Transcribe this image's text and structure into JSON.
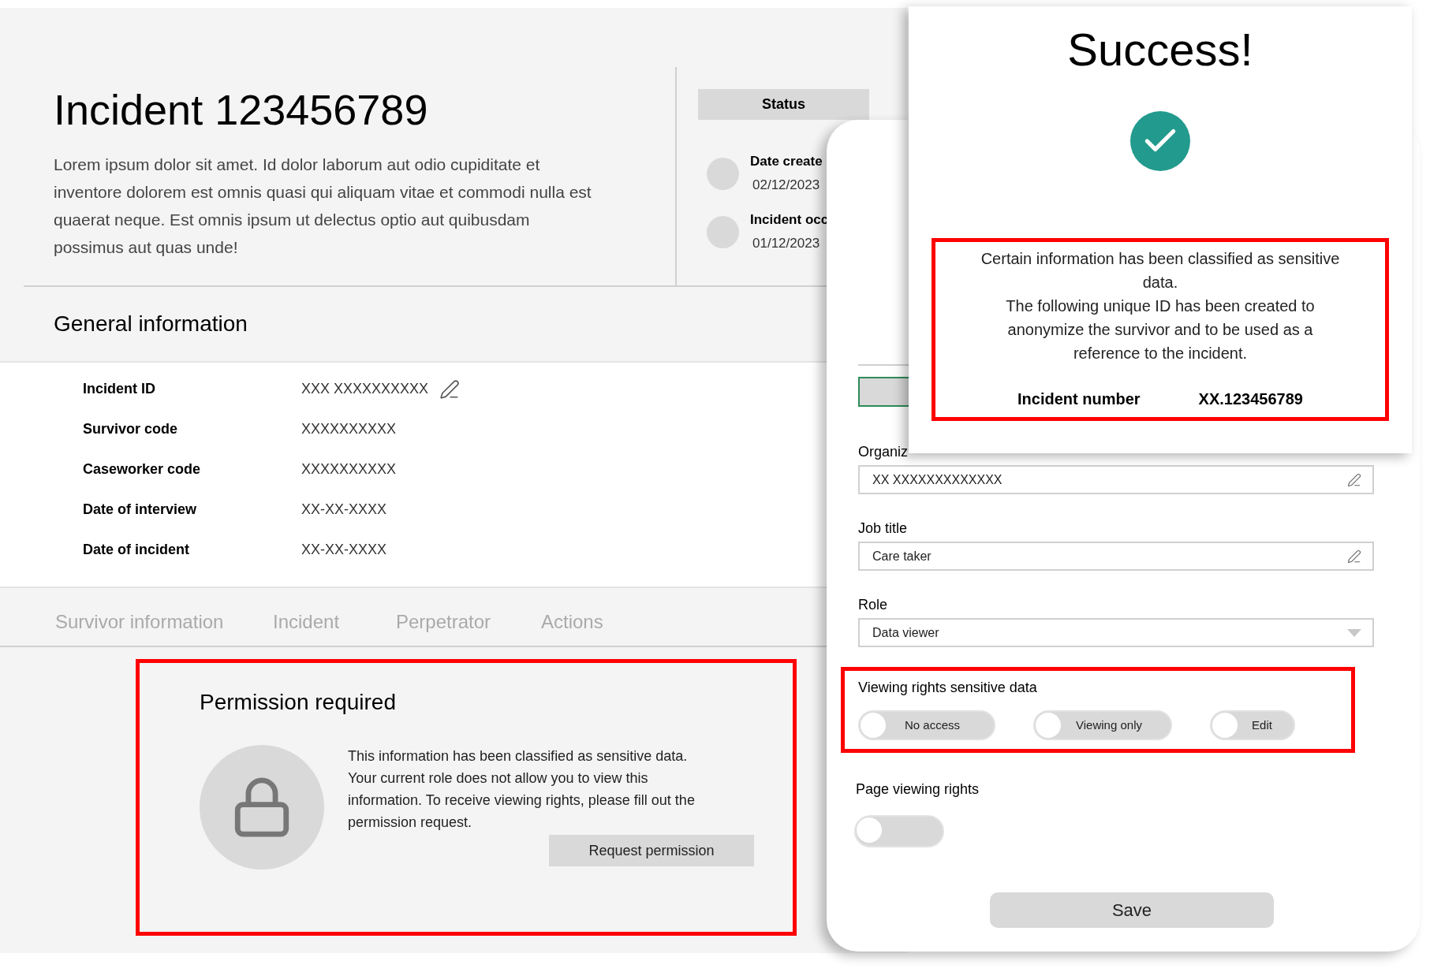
{
  "incident": {
    "title": "Incident 123456789",
    "description": "Lorem ipsum dolor sit amet. Id dolor laborum aut odio cupiditate et inventore dolorem est omnis quasi qui aliquam vitae et commodi nulla est quaerat neque. Est omnis ipsum ut delectus optio aut quibusdam possimus aut quas unde!"
  },
  "status": {
    "heading": "Status",
    "items": [
      {
        "label": "Date create",
        "date": "02/12/2023"
      },
      {
        "label": "Incident occ",
        "date": "01/12/2023"
      }
    ]
  },
  "general_information": {
    "heading": "General information",
    "rows": [
      {
        "label": "Incident ID",
        "value": "XXX XXXXXXXXXX",
        "editable": true
      },
      {
        "label": "Survivor code",
        "value": "XXXXXXXXXX",
        "editable": false
      },
      {
        "label": "Caseworker code",
        "value": "XXXXXXXXXX",
        "editable": false
      },
      {
        "label": "Date of interview",
        "value": "XX-XX-XXXX",
        "editable": false
      },
      {
        "label": "Date of incident",
        "value": "XX-XX-XXXX",
        "editable": false
      }
    ]
  },
  "tabs": [
    {
      "label": "Survivor information",
      "selected": false
    },
    {
      "label": "Incident",
      "selected": false
    },
    {
      "label": "Perpetrator",
      "selected": false
    },
    {
      "label": "Actions",
      "selected": false
    }
  ],
  "permission_notice": {
    "heading": "Permission required",
    "message": "This information has been classified as sensitive data. Your current role does not allow you to view this information. To receive viewing rights, please fill out the permission request.",
    "button": "Request permission"
  },
  "user_panel": {
    "fields": [
      {
        "kind": "text",
        "label": "Organiz",
        "value": "XX XXXXXXXXXXXXX"
      },
      {
        "kind": "text",
        "label": "Job title",
        "value": "Care taker"
      },
      {
        "kind": "select",
        "label": "Role",
        "value": "Data viewer"
      }
    ],
    "sensitive_rights": {
      "label": "Viewing rights sensitive data",
      "options": [
        {
          "label": "No access",
          "on": false
        },
        {
          "label": "Viewing only",
          "on": false
        },
        {
          "label": "Edit",
          "on": false
        }
      ]
    },
    "page_rights": {
      "label": "Page viewing rights",
      "on": false
    },
    "save_button": "Save"
  },
  "success_dialog": {
    "title": "Success!",
    "paragraphs": [
      "Certain information has been classified as sensitive data.",
      "The following unique ID has been created to anonymize the survivor and to be used as a reference to the incident."
    ],
    "reference": {
      "label": "Incident number",
      "value": "XX.123456789"
    }
  }
}
